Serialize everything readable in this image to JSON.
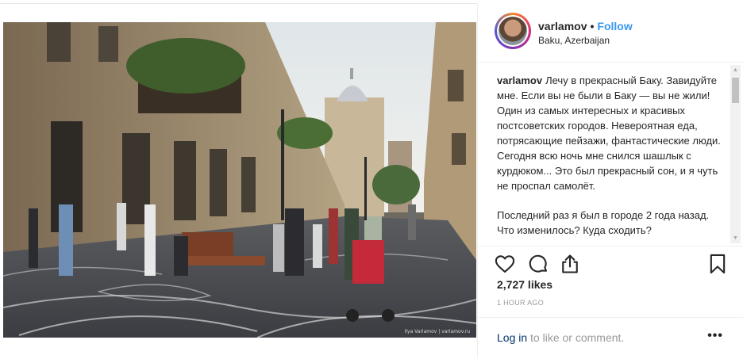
{
  "post": {
    "username": "varlamov",
    "follow_label": "Follow",
    "dot": "•",
    "location": "Baku, Azerbaijan",
    "avatar_alt": "varlamov profile picture",
    "photo_credit": "Ilya Varlamov | varlamov.ru"
  },
  "caption": {
    "user": "varlamov",
    "paragraph1": "Лечу в прекрасный Баку. Завидуйте мне. Если вы не были в Баку — вы не жили! Один из самых интересных и красивых постсоветских городов. Невероятная еда, потрясающие пейзажи, фантастические люди. Сегодня всю ночь мне снился шашлык с курдюком... Это был прекрасный сон, и я чуть не проспал самолёт.",
    "paragraph2": "Последний раз я был в городе 2 года назад. Что изменилось? Куда сходить?"
  },
  "actions": {
    "like_icon": "heart-icon",
    "comment_icon": "comment-icon",
    "share_icon": "share-icon",
    "save_icon": "bookmark-icon"
  },
  "stats": {
    "likes": "2,727 likes",
    "time": "1 HOUR AGO"
  },
  "comment_bar": {
    "login_link": "Log in",
    "login_rest": " to like or comment.",
    "more": "•••"
  },
  "colors": {
    "follow": "#3897f0",
    "link": "#003569",
    "muted": "#999999"
  }
}
